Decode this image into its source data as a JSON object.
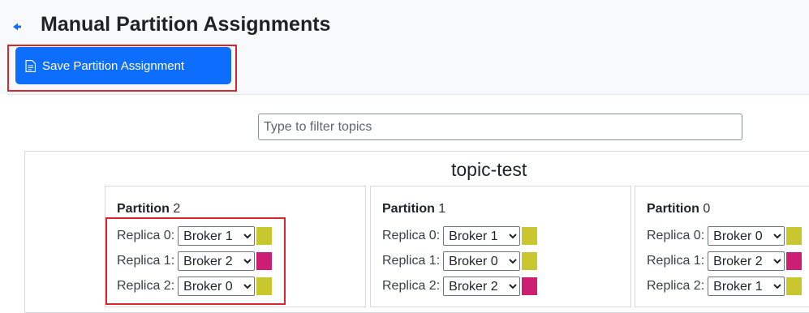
{
  "page": {
    "title": "Manual Partition Assignments",
    "save_button_label": "Save Partition Assignment"
  },
  "filter": {
    "placeholder": "Type to filter topics",
    "value": ""
  },
  "topic": {
    "name": "topic-test",
    "partition_label": "Partition",
    "partitions": [
      {
        "number": "2",
        "replicas": [
          {
            "label": "Replica 0:",
            "broker": "Broker 1",
            "color": "#c8c82e"
          },
          {
            "label": "Replica 1:",
            "broker": "Broker 2",
            "color": "#cc1f74"
          },
          {
            "label": "Replica 2:",
            "broker": "Broker 0",
            "color": "#c8c82e"
          }
        ]
      },
      {
        "number": "1",
        "replicas": [
          {
            "label": "Replica 0:",
            "broker": "Broker 1",
            "color": "#c8c82e"
          },
          {
            "label": "Replica 1:",
            "broker": "Broker 0",
            "color": "#c8c82e"
          },
          {
            "label": "Replica 2:",
            "broker": "Broker 2",
            "color": "#cc1f74"
          }
        ]
      },
      {
        "number": "0",
        "replicas": [
          {
            "label": "Replica 0:",
            "broker": "Broker 0",
            "color": "#c8c82e"
          },
          {
            "label": "Replica 1:",
            "broker": "Broker 2",
            "color": "#cc1f74"
          },
          {
            "label": "Replica 2:",
            "broker": "Broker 1",
            "color": "#c8c82e"
          }
        ]
      }
    ]
  },
  "broker_options": [
    "Broker 0",
    "Broker 1",
    "Broker 2"
  ],
  "colors": {
    "accent": "#0d6efd",
    "highlight": "#d9252b"
  }
}
